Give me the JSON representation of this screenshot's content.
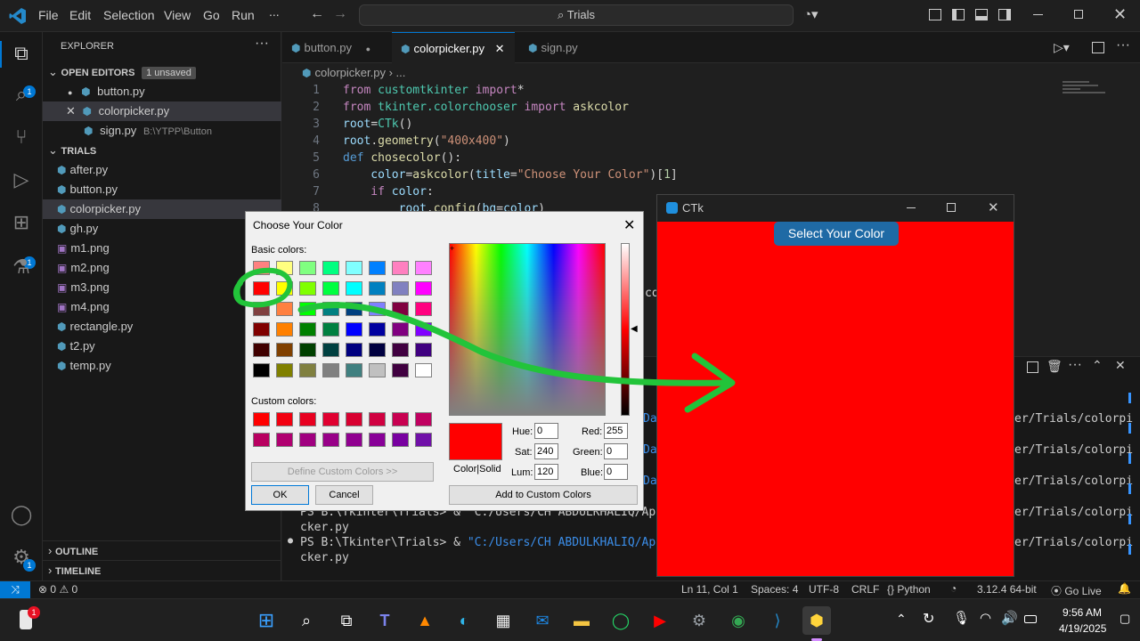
{
  "menu": [
    "File",
    "Edit",
    "Selection",
    "View",
    "Go",
    "Run",
    "..."
  ],
  "search": {
    "text": "Trials"
  },
  "sidebar": {
    "title": "EXPLORER",
    "open_editors": {
      "label": "OPEN EDITORS",
      "badge": "1 unsaved",
      "items": [
        {
          "name": "button.py",
          "path": ""
        },
        {
          "name": "colorpicker.py",
          "path": ""
        },
        {
          "name": "sign.py",
          "path": "B:\\YTPP\\Button"
        }
      ]
    },
    "trials": {
      "label": "TRIALS",
      "items": [
        "after.py",
        "button.py",
        "colorpicker.py",
        "gh.py",
        "m1.png",
        "m2.png",
        "m3.png",
        "m4.png",
        "rectangle.py",
        "t2.py",
        "temp.py"
      ]
    },
    "outline": "OUTLINE",
    "timeline": "TIMELINE"
  },
  "tabs": [
    "button.py",
    "colorpicker.py",
    "sign.py"
  ],
  "breadcrumb": {
    "file": "colorpicker.py",
    "rest": "..."
  },
  "code": {
    "line_numbers": [
      "1",
      "2",
      "3",
      "4",
      "5",
      "6",
      "7",
      "8"
    ],
    "l1": {
      "a": "from",
      "b": " customtkinter ",
      "c": "import",
      "d": "*"
    },
    "l2": {
      "a": "from",
      "b": " tkinter.colorchooser ",
      "c": "import",
      "d": " askcolor"
    },
    "l3": {
      "a": "root",
      "b": "=",
      "c": "CTk",
      "d": "()"
    },
    "l4": {
      "a": "root",
      "b": ".",
      "c": "geometry",
      "d": "(",
      "e": "\"400x400\"",
      "f": ")"
    },
    "l5": {
      "a": "def",
      "b": " ",
      "c": "chosecolor",
      "d": "():"
    },
    "l6": {
      "a": "    color",
      "b": "=",
      "c": "askcolor",
      "d": "(",
      "e": "title",
      "f": "=",
      "g": "\"Choose Your Color\"",
      "h": ")[",
      "i": "1",
      "j": "]"
    },
    "l7": {
      "a": "    if",
      "b": " ",
      "c": "color",
      "d": ":"
    },
    "l8": {
      "a": "        root",
      "b": ".",
      "c": "config",
      "d": "(",
      "e": "bg",
      "f": "=",
      "g": "color",
      "h": ")"
    },
    "frag_co": "co"
  },
  "terminal": {
    "right_lines": [
      "er/Trials/colorpi",
      "er/Trials/colorpi",
      "er/Trials/colorpi",
      "er/Trials/colorpi",
      "er/Trials/colorpi"
    ],
    "left_frags": [
      "Dat",
      "Dat",
      "Dat"
    ],
    "line_a": "PS B:\\Tkinter\\Trials> & \"C:/Users/CH ABDULKHALIQ/AppDat",
    "line_b": "cker.py",
    "line_c": "PS B:\\Tkinter\\Trials> & ",
    "line_c_str": "\"C:/Users/CH ABDULKHALIQ/AppDat",
    "line_d": "cker.py"
  },
  "status": {
    "errors": "0",
    "warnings": "0",
    "position": "Ln 11, Col 1",
    "spaces": "Spaces: 4",
    "encoding": "UTF-8",
    "eol": "CRLF",
    "language": "Python",
    "version": "3.12.4 64-bit",
    "golive": "Go Live"
  },
  "dialog": {
    "title": "Choose Your Color",
    "basic_label": "Basic colors:",
    "custom_label": "Custom colors:",
    "define_btn": "Define Custom Colors >>",
    "ok": "OK",
    "cancel": "Cancel",
    "add_btn": "Add to Custom Colors",
    "colorsolid": "Color|Solid",
    "hue_label": "Hue:",
    "hue": "0",
    "sat_label": "Sat:",
    "sat": "240",
    "lum_label": "Lum:",
    "lum": "120",
    "red_label": "Red:",
    "red": "255",
    "green_label": "Green:",
    "green": "0",
    "blue_label": "Blue:",
    "blue": "0",
    "basic_colors": [
      "#ff8080",
      "#ffff80",
      "#80ff80",
      "#00ff80",
      "#80ffff",
      "#0080ff",
      "#ff80c0",
      "#ff80ff",
      "#ff0000",
      "#ffff00",
      "#80ff00",
      "#00ff40",
      "#00ffff",
      "#0080c0",
      "#8080c0",
      "#ff00ff",
      "#804040",
      "#ff8040",
      "#00ff00",
      "#008080",
      "#004080",
      "#8080ff",
      "#800040",
      "#ff0080",
      "#800000",
      "#ff8000",
      "#008000",
      "#008040",
      "#0000ff",
      "#0000a0",
      "#800080",
      "#8000ff",
      "#400000",
      "#804000",
      "#004000",
      "#004040",
      "#000080",
      "#000040",
      "#400040",
      "#400080",
      "#000000",
      "#808000",
      "#808040",
      "#808080",
      "#408080",
      "#c0c0c0",
      "#400040",
      "#ffffff"
    ],
    "custom_colors": [
      "#ff0000",
      "#f20010",
      "#e80020",
      "#e00030",
      "#d80030",
      "#d00040",
      "#c80050",
      "#c00060",
      "#b80060",
      "#b00070",
      "#a00080",
      "#980088",
      "#900090",
      "#880098",
      "#7800a0",
      "#7010a8"
    ]
  },
  "ctk": {
    "title": "CTk",
    "button": "Select Your Color"
  },
  "taskbar": {
    "time": "9:56 AM",
    "date": "4/19/2025"
  }
}
